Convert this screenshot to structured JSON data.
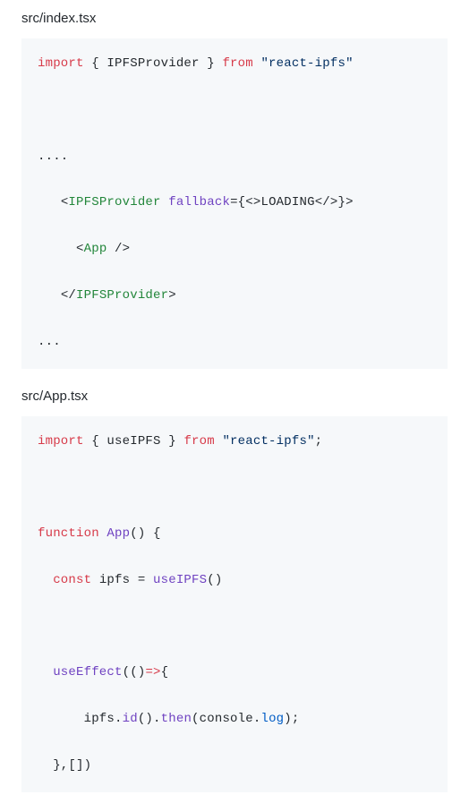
{
  "block1": {
    "filename": "src/index.tsx",
    "l1": {
      "kw": "import",
      "sym": " { IPFSProvider } ",
      "from": "from ",
      "str": "\"react-ipfs\""
    },
    "l2": "....",
    "l3": {
      "open": "<",
      "tag": "IPFSProvider ",
      "attr": "fallback",
      "eq": "={<>",
      "text": "LOADING",
      "sym": "</>}>"
    },
    "l4": {
      "open": "<",
      "tag": "App ",
      "close": "/>"
    },
    "l5": {
      "open": "</",
      "tag": "IPFSProvider",
      "close": ">"
    },
    "l6": "..."
  },
  "block2": {
    "filename": "src/App.tsx",
    "l1": {
      "kw": "import",
      "sym": " { useIPFS } ",
      "from": "from ",
      "str": "\"react-ipfs\"",
      ";": ";"
    },
    "l2": {
      "kw": "function ",
      "fn": "App",
      "rest": "() {"
    },
    "l3": {
      "kw": "const ",
      "name": "ipfs = ",
      "fn": "useIPFS",
      "rest": "()"
    },
    "l4": {
      "fn": "useEffect",
      "rest": "(()",
      "arrow": "=>",
      "brace": "{"
    },
    "l5": {
      "pre": "    ipfs.",
      "id": "id",
      "mid": "().",
      "then": "then",
      "open": "(console.",
      "log": "log",
      "end": ");"
    },
    "l6": "},[])"
  }
}
